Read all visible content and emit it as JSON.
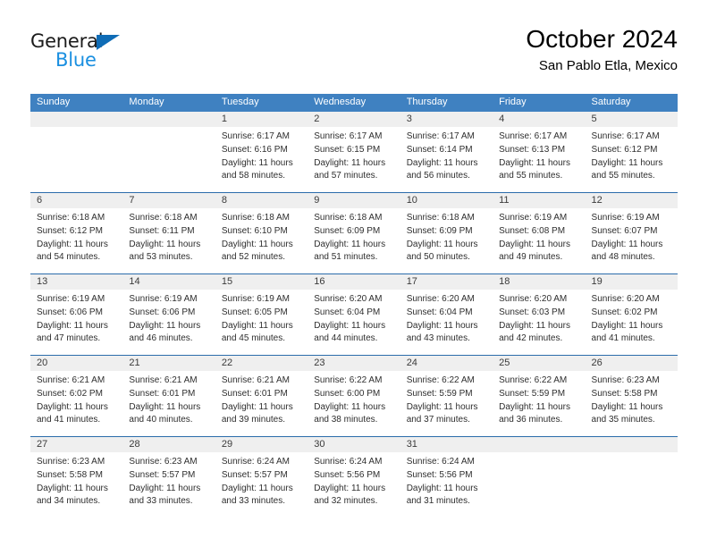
{
  "brand": {
    "name_top": "General",
    "name_bottom": "Blue",
    "triangle_color": "#0f6cb6",
    "blue_color": "#1a8fe0"
  },
  "header": {
    "title": "October 2024",
    "subtitle": "San Pablo Etla, Mexico"
  },
  "theme": {
    "header_bg": "#3f81c1",
    "row_divider": "#2b6cab",
    "day_band_bg": "#efefef"
  },
  "weekdays": [
    "Sunday",
    "Monday",
    "Tuesday",
    "Wednesday",
    "Thursday",
    "Friday",
    "Saturday"
  ],
  "weeks": [
    [
      {
        "day": "",
        "lines": []
      },
      {
        "day": "",
        "lines": []
      },
      {
        "day": "1",
        "lines": [
          "Sunrise: 6:17 AM",
          "Sunset: 6:16 PM",
          "Daylight: 11 hours",
          "and 58 minutes."
        ]
      },
      {
        "day": "2",
        "lines": [
          "Sunrise: 6:17 AM",
          "Sunset: 6:15 PM",
          "Daylight: 11 hours",
          "and 57 minutes."
        ]
      },
      {
        "day": "3",
        "lines": [
          "Sunrise: 6:17 AM",
          "Sunset: 6:14 PM",
          "Daylight: 11 hours",
          "and 56 minutes."
        ]
      },
      {
        "day": "4",
        "lines": [
          "Sunrise: 6:17 AM",
          "Sunset: 6:13 PM",
          "Daylight: 11 hours",
          "and 55 minutes."
        ]
      },
      {
        "day": "5",
        "lines": [
          "Sunrise: 6:17 AM",
          "Sunset: 6:12 PM",
          "Daylight: 11 hours",
          "and 55 minutes."
        ]
      }
    ],
    [
      {
        "day": "6",
        "lines": [
          "Sunrise: 6:18 AM",
          "Sunset: 6:12 PM",
          "Daylight: 11 hours",
          "and 54 minutes."
        ]
      },
      {
        "day": "7",
        "lines": [
          "Sunrise: 6:18 AM",
          "Sunset: 6:11 PM",
          "Daylight: 11 hours",
          "and 53 minutes."
        ]
      },
      {
        "day": "8",
        "lines": [
          "Sunrise: 6:18 AM",
          "Sunset: 6:10 PM",
          "Daylight: 11 hours",
          "and 52 minutes."
        ]
      },
      {
        "day": "9",
        "lines": [
          "Sunrise: 6:18 AM",
          "Sunset: 6:09 PM",
          "Daylight: 11 hours",
          "and 51 minutes."
        ]
      },
      {
        "day": "10",
        "lines": [
          "Sunrise: 6:18 AM",
          "Sunset: 6:09 PM",
          "Daylight: 11 hours",
          "and 50 minutes."
        ]
      },
      {
        "day": "11",
        "lines": [
          "Sunrise: 6:19 AM",
          "Sunset: 6:08 PM",
          "Daylight: 11 hours",
          "and 49 minutes."
        ]
      },
      {
        "day": "12",
        "lines": [
          "Sunrise: 6:19 AM",
          "Sunset: 6:07 PM",
          "Daylight: 11 hours",
          "and 48 minutes."
        ]
      }
    ],
    [
      {
        "day": "13",
        "lines": [
          "Sunrise: 6:19 AM",
          "Sunset: 6:06 PM",
          "Daylight: 11 hours",
          "and 47 minutes."
        ]
      },
      {
        "day": "14",
        "lines": [
          "Sunrise: 6:19 AM",
          "Sunset: 6:06 PM",
          "Daylight: 11 hours",
          "and 46 minutes."
        ]
      },
      {
        "day": "15",
        "lines": [
          "Sunrise: 6:19 AM",
          "Sunset: 6:05 PM",
          "Daylight: 11 hours",
          "and 45 minutes."
        ]
      },
      {
        "day": "16",
        "lines": [
          "Sunrise: 6:20 AM",
          "Sunset: 6:04 PM",
          "Daylight: 11 hours",
          "and 44 minutes."
        ]
      },
      {
        "day": "17",
        "lines": [
          "Sunrise: 6:20 AM",
          "Sunset: 6:04 PM",
          "Daylight: 11 hours",
          "and 43 minutes."
        ]
      },
      {
        "day": "18",
        "lines": [
          "Sunrise: 6:20 AM",
          "Sunset: 6:03 PM",
          "Daylight: 11 hours",
          "and 42 minutes."
        ]
      },
      {
        "day": "19",
        "lines": [
          "Sunrise: 6:20 AM",
          "Sunset: 6:02 PM",
          "Daylight: 11 hours",
          "and 41 minutes."
        ]
      }
    ],
    [
      {
        "day": "20",
        "lines": [
          "Sunrise: 6:21 AM",
          "Sunset: 6:02 PM",
          "Daylight: 11 hours",
          "and 41 minutes."
        ]
      },
      {
        "day": "21",
        "lines": [
          "Sunrise: 6:21 AM",
          "Sunset: 6:01 PM",
          "Daylight: 11 hours",
          "and 40 minutes."
        ]
      },
      {
        "day": "22",
        "lines": [
          "Sunrise: 6:21 AM",
          "Sunset: 6:01 PM",
          "Daylight: 11 hours",
          "and 39 minutes."
        ]
      },
      {
        "day": "23",
        "lines": [
          "Sunrise: 6:22 AM",
          "Sunset: 6:00 PM",
          "Daylight: 11 hours",
          "and 38 minutes."
        ]
      },
      {
        "day": "24",
        "lines": [
          "Sunrise: 6:22 AM",
          "Sunset: 5:59 PM",
          "Daylight: 11 hours",
          "and 37 minutes."
        ]
      },
      {
        "day": "25",
        "lines": [
          "Sunrise: 6:22 AM",
          "Sunset: 5:59 PM",
          "Daylight: 11 hours",
          "and 36 minutes."
        ]
      },
      {
        "day": "26",
        "lines": [
          "Sunrise: 6:23 AM",
          "Sunset: 5:58 PM",
          "Daylight: 11 hours",
          "and 35 minutes."
        ]
      }
    ],
    [
      {
        "day": "27",
        "lines": [
          "Sunrise: 6:23 AM",
          "Sunset: 5:58 PM",
          "Daylight: 11 hours",
          "and 34 minutes."
        ]
      },
      {
        "day": "28",
        "lines": [
          "Sunrise: 6:23 AM",
          "Sunset: 5:57 PM",
          "Daylight: 11 hours",
          "and 33 minutes."
        ]
      },
      {
        "day": "29",
        "lines": [
          "Sunrise: 6:24 AM",
          "Sunset: 5:57 PM",
          "Daylight: 11 hours",
          "and 33 minutes."
        ]
      },
      {
        "day": "30",
        "lines": [
          "Sunrise: 6:24 AM",
          "Sunset: 5:56 PM",
          "Daylight: 11 hours",
          "and 32 minutes."
        ]
      },
      {
        "day": "31",
        "lines": [
          "Sunrise: 6:24 AM",
          "Sunset: 5:56 PM",
          "Daylight: 11 hours",
          "and 31 minutes."
        ]
      },
      {
        "day": "",
        "lines": []
      },
      {
        "day": "",
        "lines": []
      }
    ]
  ]
}
